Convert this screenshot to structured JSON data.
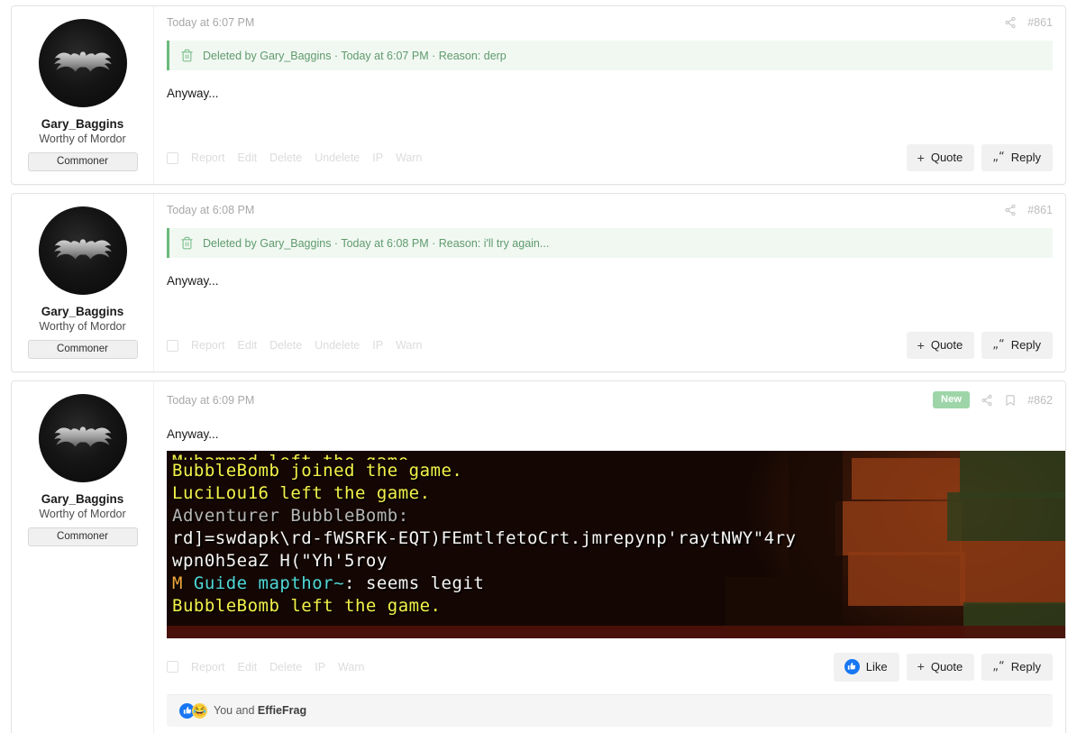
{
  "user": {
    "name": "Gary_Baggins",
    "title": "Worthy of Mordor",
    "badge": "Commoner",
    "avatar_icon": "batman-logo-avatar"
  },
  "icons": {
    "share": "share-icon",
    "bookmark": "bookmark-icon",
    "trash": "trash-icon",
    "checkbox": "checkbox-icon",
    "thumbs_up": "thumbs-up-icon",
    "laugh": "laughing-emoji-icon",
    "quote_marks": "quote-marks-icon",
    "plus": "plus-icon"
  },
  "posts": [
    {
      "time": "Today at 6:07 PM",
      "post_number": "#861",
      "new_badge": null,
      "has_bookmark": false,
      "deleted_notice": "Deleted by Gary_Baggins · Today at 6:07 PM · Reason: derp",
      "message": "Anyway...",
      "has_image": false,
      "actions": [
        "Report",
        "Edit",
        "Delete",
        "Undelete",
        "IP",
        "Warn"
      ],
      "buttons": {
        "like": null,
        "quote": "Quote",
        "reply": "Reply"
      },
      "reactions": null
    },
    {
      "time": "Today at 6:08 PM",
      "post_number": "#861",
      "new_badge": null,
      "has_bookmark": false,
      "deleted_notice": "Deleted by Gary_Baggins · Today at 6:08 PM · Reason: i'll try again...",
      "message": "Anyway...",
      "has_image": false,
      "actions": [
        "Report",
        "Edit",
        "Delete",
        "Undelete",
        "IP",
        "Warn"
      ],
      "buttons": {
        "like": null,
        "quote": "Quote",
        "reply": "Reply"
      },
      "reactions": null
    },
    {
      "time": "Today at 6:09 PM",
      "post_number": "#862",
      "new_badge": "New",
      "has_bookmark": true,
      "deleted_notice": null,
      "message": "Anyway...",
      "has_image": true,
      "actions": [
        "Report",
        "Edit",
        "Delete",
        "IP",
        "Warn"
      ],
      "buttons": {
        "like": "Like",
        "quote": "Quote",
        "reply": "Reply"
      },
      "reactions": {
        "text_prefix": "You and ",
        "text_name": "EffieFrag"
      }
    }
  ],
  "minecraft_chat": {
    "lines": [
      {
        "text": "Muhammad left the game.",
        "color": "yellow",
        "cut": true
      },
      {
        "text": "BubbleBomb joined the game.",
        "color": "yellow",
        "cut": false
      },
      {
        "text": "LuciLou16 left the game.",
        "color": "yellow",
        "cut": false
      },
      {
        "text": "Adventurer BubbleBomb:",
        "color": "gray",
        "cut": false
      },
      {
        "text": "rd]=swdapk\\rd-fWSRFK-EQT)FEmtlfetoCrt.jmrepynp'raytNWY\"4ry",
        "color": "white",
        "cut": false
      },
      {
        "text": "wpn0h5eaZ H(\"Yh'5roy",
        "color": "white",
        "cut": false
      },
      {
        "text": "M Guide mapthor~: seems legit",
        "color": "mixed",
        "cut": false
      },
      {
        "text": "BubbleBomb left the game.",
        "color": "yellow",
        "cut": false
      }
    ],
    "mixed_line": {
      "prefix": "M ",
      "name": "Guide mapthor~",
      "sep": ": ",
      "body": "seems legit"
    }
  },
  "colors": {
    "page_background": "#ffffff",
    "card_border": "#e3e3e3",
    "deleted_notice_bg": "#f1f8f2",
    "deleted_notice_accent": "#6aba7c",
    "new_badge": "#9ed5a8",
    "like_blue": "#1877f2",
    "action_link": "#dcdcdc",
    "reaction_bar_bg": "#f5f5f5"
  }
}
